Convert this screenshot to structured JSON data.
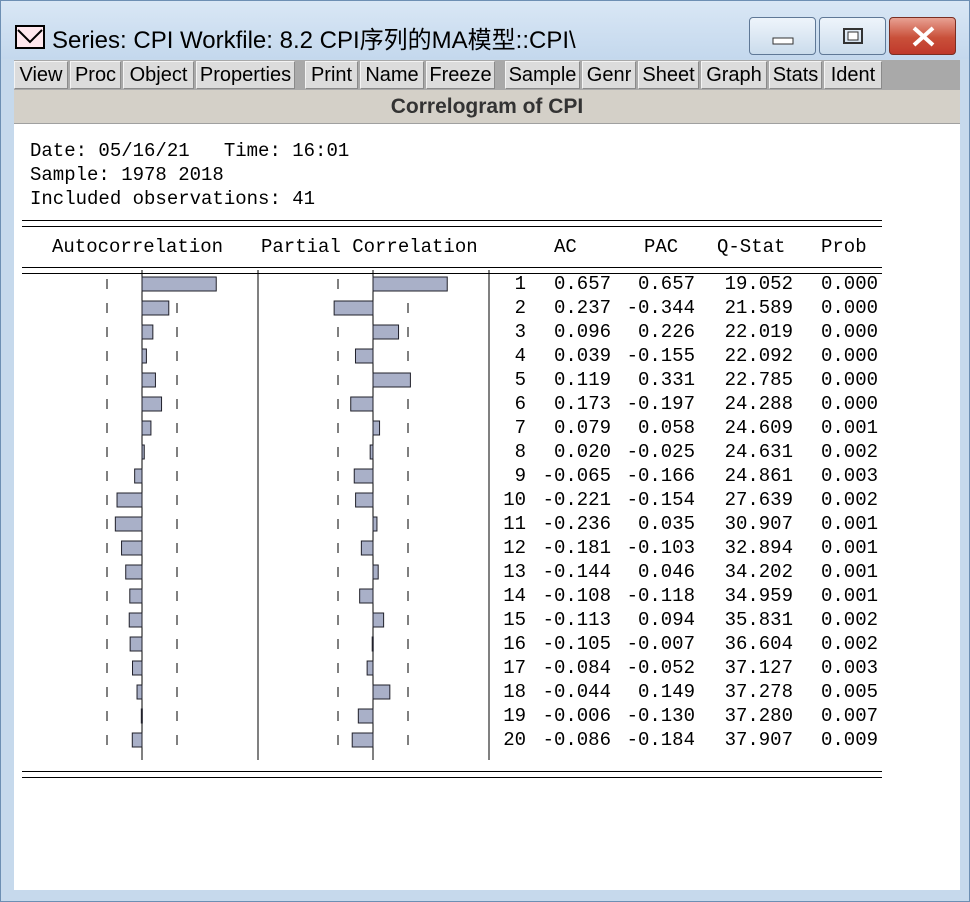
{
  "window": {
    "title": "Series: CPI   Workfile: 8.2 CPI序列的MA模型::CPI\\",
    "icon": "series-icon",
    "controls": [
      "minimize-icon",
      "maximize-icon",
      "close-icon"
    ]
  },
  "toolbar": {
    "buttons": [
      "View",
      "Proc",
      "Object",
      "Properties",
      "Print",
      "Name",
      "Freeze",
      "Sample",
      "Genr",
      "Sheet",
      "Graph",
      "Stats",
      "Ident"
    ]
  },
  "view": {
    "title": "Correlogram of CPI",
    "header": {
      "date_line": "Date: 05/16/21   Time: 16:01",
      "sample_line": "Sample: 1978 2018",
      "obs_line": "Included observations: 41"
    },
    "columns": [
      "Autocorrelation",
      "Partial Correlation",
      "AC",
      "PAC",
      "Q-Stat",
      "Prob"
    ],
    "rows": [
      {
        "lag": "1",
        "ac": "0.657",
        "pac": "0.657",
        "q": "19.052",
        "prob": "0.000"
      },
      {
        "lag": "2",
        "ac": "0.237",
        "pac": "-0.344",
        "q": "21.589",
        "prob": "0.000"
      },
      {
        "lag": "3",
        "ac": "0.096",
        "pac": "0.226",
        "q": "22.019",
        "prob": "0.000"
      },
      {
        "lag": "4",
        "ac": "0.039",
        "pac": "-0.155",
        "q": "22.092",
        "prob": "0.000"
      },
      {
        "lag": "5",
        "ac": "0.119",
        "pac": "0.331",
        "q": "22.785",
        "prob": "0.000"
      },
      {
        "lag": "6",
        "ac": "0.173",
        "pac": "-0.197",
        "q": "24.288",
        "prob": "0.000"
      },
      {
        "lag": "7",
        "ac": "0.079",
        "pac": "0.058",
        "q": "24.609",
        "prob": "0.001"
      },
      {
        "lag": "8",
        "ac": "0.020",
        "pac": "-0.025",
        "q": "24.631",
        "prob": "0.002"
      },
      {
        "lag": "9",
        "ac": "-0.065",
        "pac": "-0.166",
        "q": "24.861",
        "prob": "0.003"
      },
      {
        "lag": "10",
        "ac": "-0.221",
        "pac": "-0.154",
        "q": "27.639",
        "prob": "0.002"
      },
      {
        "lag": "11",
        "ac": "-0.236",
        "pac": "0.035",
        "q": "30.907",
        "prob": "0.001"
      },
      {
        "lag": "12",
        "ac": "-0.181",
        "pac": "-0.103",
        "q": "32.894",
        "prob": "0.001"
      },
      {
        "lag": "13",
        "ac": "-0.144",
        "pac": "0.046",
        "q": "34.202",
        "prob": "0.001"
      },
      {
        "lag": "14",
        "ac": "-0.108",
        "pac": "-0.118",
        "q": "34.959",
        "prob": "0.001"
      },
      {
        "lag": "15",
        "ac": "-0.113",
        "pac": "0.094",
        "q": "35.831",
        "prob": "0.002"
      },
      {
        "lag": "16",
        "ac": "-0.105",
        "pac": "-0.007",
        "q": "36.604",
        "prob": "0.002"
      },
      {
        "lag": "17",
        "ac": "-0.084",
        "pac": "-0.052",
        "q": "37.127",
        "prob": "0.003"
      },
      {
        "lag": "18",
        "ac": "-0.044",
        "pac": "0.149",
        "q": "37.278",
        "prob": "0.005"
      },
      {
        "lag": "19",
        "ac": "-0.006",
        "pac": "-0.130",
        "q": "37.280",
        "prob": "0.007"
      },
      {
        "lag": "20",
        "ac": "-0.086",
        "pac": "-0.184",
        "q": "37.907",
        "prob": "0.009"
      }
    ],
    "colors": {
      "bar_fill": "#a9b0c8",
      "bar_stroke": "#20202a"
    }
  }
}
